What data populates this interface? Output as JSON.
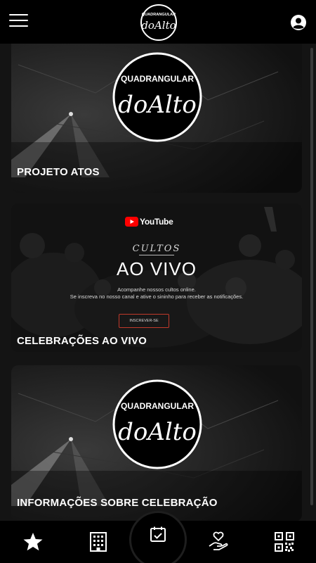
{
  "header": {
    "menu_icon": "hamburger-menu-icon",
    "logo_top_text": "QUADRANGULAR",
    "logo_script_text": "doAlto",
    "profile_icon": "user-account-icon"
  },
  "cards": [
    {
      "title": "PROJETO ATOS",
      "logo_top_text": "QUADRANGULAR",
      "logo_script_text": "doAlto"
    },
    {
      "title": "CELEBRAÇÕES AO VIVO",
      "youtube_label": "YouTube",
      "cultos_label": "CULTOS",
      "ao_vivo_label": "AO VIVO",
      "description_line1": "Acompanhe nossos cultos online.",
      "description_line2": "Se inscreva no nosso canal e ative o sininho para receber as notificações.",
      "subscribe_label": "INSCREVER-SE"
    },
    {
      "title": "INFORMAÇÕES SOBRE CELEBRAÇÃO",
      "logo_top_text": "QUADRANGULAR",
      "logo_script_text": "doAlto"
    }
  ],
  "bottom_nav": {
    "items": [
      {
        "icon": "star-icon"
      },
      {
        "icon": "building-icon"
      },
      {
        "icon": "calendar-check-icon"
      },
      {
        "icon": "hand-heart-icon"
      },
      {
        "icon": "qr-code-icon"
      }
    ]
  },
  "colors": {
    "background": "#141414",
    "bar": "#000000",
    "youtube_red": "#ff0000",
    "subscribe_border": "#c0392b"
  }
}
